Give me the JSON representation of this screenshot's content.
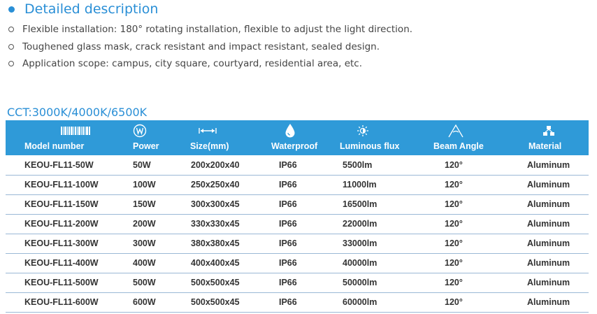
{
  "section": {
    "title": "Detailed description"
  },
  "description": [
    "Flexible installation: 180° rotating installation, flexible to adjust the light direction.",
    "Toughened glass mask, crack resistant and impact resistant, sealed design.",
    "Application scope: campus, city square, courtyard, residential area, etc."
  ],
  "cct": "CCT:3000K/4000K/6500K",
  "colors": {
    "accent": "#2a8fd6",
    "header_bg": "#2f9ad8",
    "row_border": "#9ab8d6"
  },
  "table": {
    "headers": [
      {
        "label": "Model number",
        "icon": "barcode-icon"
      },
      {
        "label": "Power",
        "icon": "power-w-icon"
      },
      {
        "label": "Size(mm)",
        "icon": "size-arrows-icon"
      },
      {
        "label": "Waterproof",
        "icon": "water-drop-icon"
      },
      {
        "label": "Luminous flux",
        "icon": "sun-icon"
      },
      {
        "label": "Beam Angle",
        "icon": "angle-icon"
      },
      {
        "label": "Material",
        "icon": "material-icon"
      }
    ],
    "rows": [
      [
        "KEOU-FL11-50W",
        "50W",
        "200x200x40",
        "IP66",
        "5500lm",
        "120°",
        "Aluminum"
      ],
      [
        "KEOU-FL11-100W",
        "100W",
        "250x250x40",
        "IP66",
        "11000lm",
        "120°",
        "Aluminum"
      ],
      [
        "KEOU-FL11-150W",
        "150W",
        "300x300x45",
        "IP66",
        "16500lm",
        "120°",
        "Aluminum"
      ],
      [
        "KEOU-FL11-200W",
        "200W",
        "330x330x45",
        "IP66",
        "22000lm",
        "120°",
        "Aluminum"
      ],
      [
        "KEOU-FL11-300W",
        "300W",
        "380x380x45",
        "IP66",
        "33000lm",
        "120°",
        "Aluminum"
      ],
      [
        "KEOU-FL11-400W",
        "400W",
        "400x400x45",
        "IP66",
        "40000lm",
        "120°",
        "Aluminum"
      ],
      [
        "KEOU-FL11-500W",
        "500W",
        "500x500x45",
        "IP66",
        "50000lm",
        "120°",
        "Aluminum"
      ],
      [
        "KEOU-FL11-600W",
        "600W",
        "500x500x45",
        "IP66",
        "60000lm",
        "120°",
        "Aluminum"
      ]
    ]
  }
}
